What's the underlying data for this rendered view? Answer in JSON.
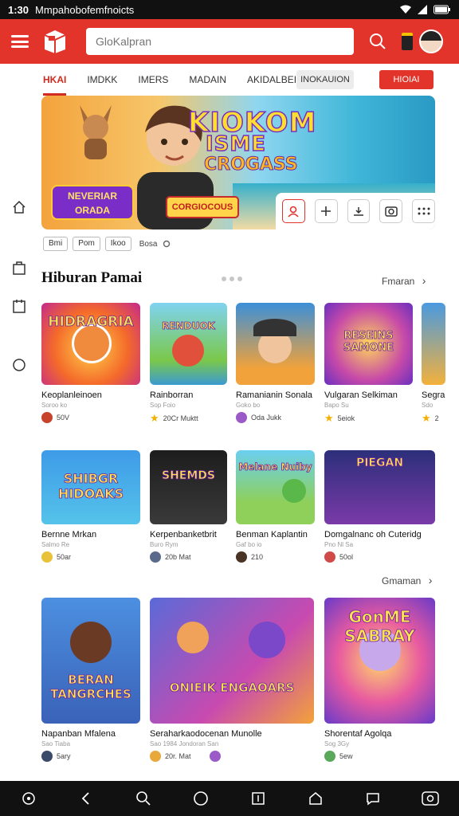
{
  "status": {
    "time": "1:30",
    "notification_text": "Mmpahobofemfnoicts"
  },
  "appbar": {
    "search_placeholder": "GloKalpran"
  },
  "tabs": [
    {
      "label": "HKAI",
      "active": true
    },
    {
      "label": "IMDKK",
      "active": false
    },
    {
      "label": "IMERS",
      "active": false
    },
    {
      "label": "MADAIN",
      "active": false
    },
    {
      "label": "AKIDALBEI",
      "active": false
    }
  ],
  "chips": {
    "grey": "INOKAUION",
    "red": "HIOIAI"
  },
  "banner": {
    "title": "KIOKOM",
    "title2": "ISME",
    "subtitle": "CROGASS",
    "badge": "NEVERIAR ORADA",
    "badge2": "CORGIOCOUS"
  },
  "filter_pills": [
    "Bmi",
    "Pom",
    "Ikoo"
  ],
  "filter_text": "Bosa",
  "section": {
    "title": "Hiburan Pamai",
    "see_more_1": "Fmaran",
    "see_more_2": "Gmaman"
  },
  "row1": [
    {
      "thumb_title": "HIDRAGRIA",
      "title": "Keoplanleinoen",
      "sub": "Soroo ko",
      "meta": "50V"
    },
    {
      "thumb_title": "RENDUOK",
      "title": "Rainborran",
      "sub": "Sop Foio",
      "meta": "20Cr Muktt"
    },
    {
      "thumb_title": "",
      "title": "Ramanianin Sonala",
      "sub": "Goko bo",
      "meta": "Oda Jukk"
    },
    {
      "thumb_title": "RESEINS SAMONE",
      "title": "Vulgaran Selkiman",
      "sub": "Bapo Su",
      "meta": "5eiok"
    },
    {
      "thumb_title": "",
      "title": "Segra",
      "sub": "Sdo",
      "meta": "2"
    }
  ],
  "row2": [
    {
      "thumb_title": "SHIBGR HIDOAKS",
      "title": "Bernne Mrkan",
      "sub": "Salmo Re",
      "meta": "50ar"
    },
    {
      "thumb_title": "SHEMDS",
      "title": "Kerpenbanketbrit",
      "sub": "Buro Rym",
      "meta": "20b Mat"
    },
    {
      "thumb_title": "Melane Nuiby",
      "title": "Benman Kaplantin",
      "sub": "Gaf bo io",
      "meta": "210"
    },
    {
      "thumb_title": "PIEGAN",
      "title": "Domgalnanc oh Cuteridg",
      "sub": "Pno Nl Sa",
      "meta": "50ol"
    }
  ],
  "row3": [
    {
      "thumb_title": "BERAN TANGRCHES",
      "title": "Napanban Mfalena",
      "sub": "Sao Tiaba",
      "meta": "5ary"
    },
    {
      "thumb_title": "ONIEIK ENGAOARS",
      "title": "Seraharkaodocenan Munolle",
      "sub": "Sao 1984 Jondoran San",
      "meta": "20r. Mat"
    },
    {
      "thumb_title": "GonME SABRAY",
      "title": "Shorentaf Agolqa",
      "sub": "Sog 3Gy",
      "meta": "5ew"
    }
  ]
}
